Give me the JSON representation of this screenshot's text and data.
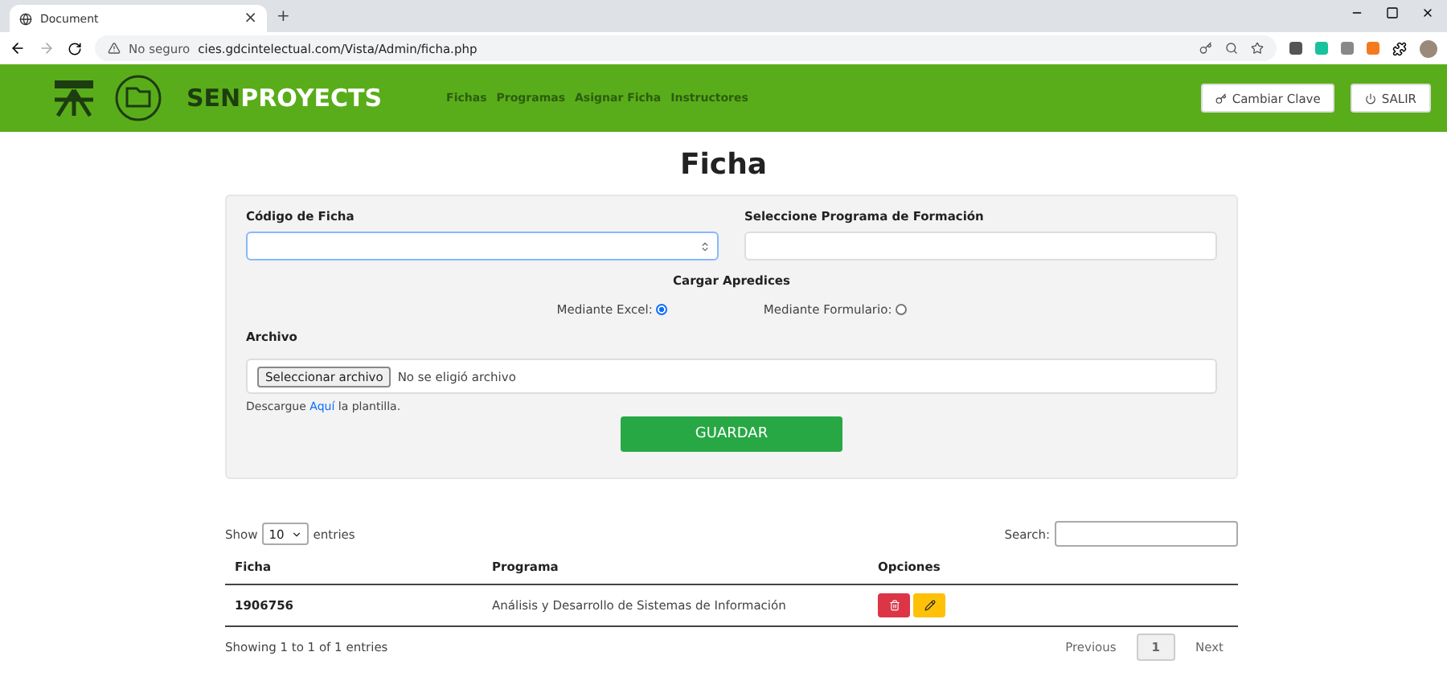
{
  "browser": {
    "tabs": [
      {
        "label": "Document",
        "selected": true
      }
    ],
    "new_tab": "+",
    "close": "×",
    "security": "No seguro",
    "url": "cies.gdcintelectual.com/Vista/Admin/ficha.php"
  },
  "header": {
    "brand_dark": "SEN",
    "brand_light": "PROYECTS",
    "nav": [
      "Fichas",
      "Programas",
      "Asignar Ficha",
      "Instructores"
    ],
    "buttons": [
      {
        "kind": "key",
        "label": "Cambiar Clave"
      },
      {
        "kind": "power",
        "label": "SALIR"
      }
    ]
  },
  "page_title": "Ficha",
  "form": {
    "codigo_label": "Código de Ficha",
    "programa_label": "Seleccione Programa de Formación",
    "cargar_label": "Cargar Apredices",
    "options": [
      {
        "label": "Mediante Excel:",
        "selected": true
      },
      {
        "label": "Mediante Formulario:",
        "selected": false
      }
    ],
    "archivo_label": "Archivo",
    "file_button": "Seleccionar archivo",
    "file_status": "No se eligió archivo",
    "download_prefix": "Descargue",
    "download_link": "Aquí",
    "download_suffix": "la plantilla.",
    "submit": "GUARDAR"
  },
  "table": {
    "show_label": "Show",
    "page_size": "10",
    "entries_label": "entries",
    "search_label": "Search:",
    "columns": [
      "Ficha",
      "Programa",
      "Opciones"
    ],
    "rows": [
      {
        "ficha": "1906756",
        "programa": "Análisis y Desarrollo de Sistemas de Información"
      }
    ],
    "info": "Showing 1 to 1 of 1 entries",
    "pagination": [
      {
        "label": "Previous",
        "kind": "nav",
        "selected": false
      },
      {
        "label": "1",
        "kind": "page",
        "selected": true
      },
      {
        "label": "Next",
        "kind": "nav",
        "selected": false
      }
    ]
  }
}
